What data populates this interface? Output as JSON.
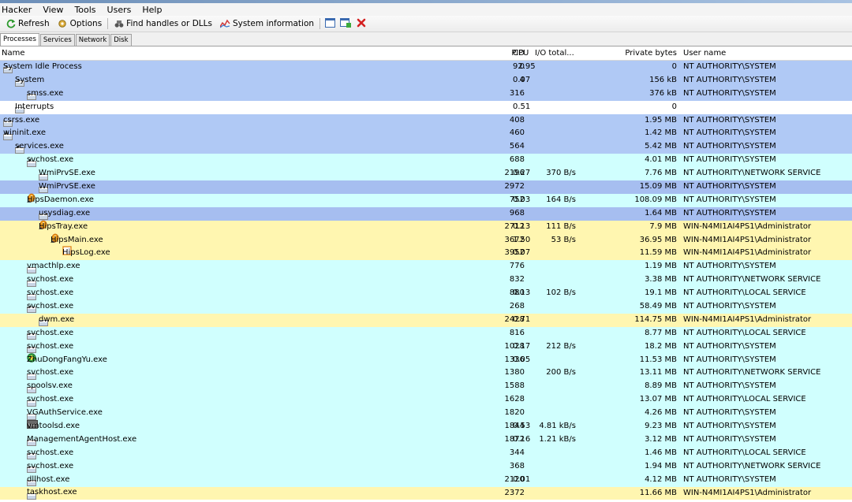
{
  "menu": [
    "Hacker",
    "View",
    "Tools",
    "Users",
    "Help"
  ],
  "toolbar": {
    "refresh": "Refresh",
    "options": "Options",
    "find": "Find handles or DLLs",
    "sysinfo": "System information"
  },
  "tabs": [
    "Processes",
    "Services",
    "Network",
    "Disk"
  ],
  "columns": {
    "name": "Name",
    "pid": "PID",
    "cpu": "CPU",
    "io": "I/O total...",
    "private": "Private bytes",
    "user": "User name"
  },
  "colors": {
    "service": "#b0c9f5",
    "process": "#d0fffe",
    "own": "#fff6b0",
    "system": "#ffffff"
  },
  "processes": [
    {
      "name": "System Idle Process",
      "pid": "0",
      "cpu": "92.95",
      "io": "",
      "priv": "0",
      "user": "NT AUTHORITY\\SYSTEM",
      "level": 0,
      "exp": true,
      "bg": "blue",
      "icon": "window-icon"
    },
    {
      "name": "System",
      "pid": "4",
      "cpu": "0.07",
      "io": "",
      "priv": "156 kB",
      "user": "NT AUTHORITY\\SYSTEM",
      "level": 1,
      "exp": true,
      "bg": "blue",
      "icon": "window-icon"
    },
    {
      "name": "smss.exe",
      "pid": "316",
      "cpu": "",
      "io": "",
      "priv": "376 kB",
      "user": "NT AUTHORITY\\SYSTEM",
      "level": 2,
      "exp": false,
      "bg": "blue",
      "icon": "window-icon"
    },
    {
      "name": "Interrupts",
      "pid": "",
      "cpu": "0.51",
      "io": "",
      "priv": "0",
      "user": "",
      "level": 1,
      "exp": false,
      "bg": "white",
      "icon": "window-icon"
    },
    {
      "name": "csrss.exe",
      "pid": "408",
      "cpu": "",
      "io": "",
      "priv": "1.95 MB",
      "user": "NT AUTHORITY\\SYSTEM",
      "level": 0,
      "exp": false,
      "bg": "blue",
      "icon": "window-icon"
    },
    {
      "name": "wininit.exe",
      "pid": "460",
      "cpu": "",
      "io": "",
      "priv": "1.42 MB",
      "user": "NT AUTHORITY\\SYSTEM",
      "level": 0,
      "exp": true,
      "bg": "blue",
      "icon": "window-icon"
    },
    {
      "name": "services.exe",
      "pid": "564",
      "cpu": "",
      "io": "",
      "priv": "5.42 MB",
      "user": "NT AUTHORITY\\SYSTEM",
      "level": 1,
      "exp": true,
      "bg": "blue",
      "icon": "window-icon"
    },
    {
      "name": "svchost.exe",
      "pid": "688",
      "cpu": "",
      "io": "",
      "priv": "4.01 MB",
      "user": "NT AUTHORITY\\SYSTEM",
      "level": 2,
      "exp": true,
      "bg": "cyan",
      "icon": "window-icon"
    },
    {
      "name": "WmiPrvSE.exe",
      "pid": "2196",
      "cpu": "0.27",
      "io": "370 B/s",
      "priv": "7.76 MB",
      "user": "NT AUTHORITY\\NETWORK SERVICE",
      "level": 3,
      "exp": false,
      "bg": "cyan",
      "icon": "window-icon"
    },
    {
      "name": "WmiPrvSE.exe",
      "pid": "2972",
      "cpu": "",
      "io": "",
      "priv": "15.09 MB",
      "user": "NT AUTHORITY\\SYSTEM",
      "level": 3,
      "exp": false,
      "bg": "dblue",
      "icon": "window-icon"
    },
    {
      "name": "HipsDaemon.exe",
      "pid": "752",
      "cpu": "0.03",
      "io": "164 B/s",
      "priv": "108.09 MB",
      "user": "NT AUTHORITY\\SYSTEM",
      "level": 2,
      "exp": true,
      "bg": "cyan",
      "icon": "shield-icon"
    },
    {
      "name": "usysdiag.exe",
      "pid": "968",
      "cpu": "",
      "io": "",
      "priv": "1.64 MB",
      "user": "NT AUTHORITY\\SYSTEM",
      "level": 3,
      "exp": false,
      "bg": "dblue",
      "icon": "window-icon"
    },
    {
      "name": "HipsTray.exe",
      "pid": "2712",
      "cpu": "0.13",
      "io": "111 B/s",
      "priv": "7.9 MB",
      "user": "WIN-N4MI1AI4PS1\\Administrator",
      "level": 3,
      "exp": true,
      "bg": "yellow",
      "icon": "shield-icon"
    },
    {
      "name": "HipsMain.exe",
      "pid": "3672",
      "cpu": "1.50",
      "io": "53 B/s",
      "priv": "36.95 MB",
      "user": "WIN-N4MI1AI4PS1\\Administrator",
      "level": 4,
      "exp": true,
      "bg": "yellow",
      "icon": "shield-icon"
    },
    {
      "name": "HipsLog.exe",
      "pid": "3952",
      "cpu": "0.07",
      "io": "",
      "priv": "11.59 MB",
      "user": "WIN-N4MI1AI4PS1\\Administrator",
      "level": 5,
      "exp": false,
      "bg": "yellow",
      "icon": "log-icon"
    },
    {
      "name": "vmacthlp.exe",
      "pid": "776",
      "cpu": "",
      "io": "",
      "priv": "1.19 MB",
      "user": "NT AUTHORITY\\SYSTEM",
      "level": 2,
      "exp": false,
      "bg": "cyan",
      "icon": "window-icon"
    },
    {
      "name": "svchost.exe",
      "pid": "832",
      "cpu": "",
      "io": "",
      "priv": "3.38 MB",
      "user": "NT AUTHORITY\\NETWORK SERVICE",
      "level": 2,
      "exp": false,
      "bg": "cyan",
      "icon": "window-icon"
    },
    {
      "name": "svchost.exe",
      "pid": "880",
      "cpu": "0.13",
      "io": "102 B/s",
      "priv": "19.1 MB",
      "user": "NT AUTHORITY\\LOCAL SERVICE",
      "level": 2,
      "exp": false,
      "bg": "cyan",
      "icon": "window-icon"
    },
    {
      "name": "svchost.exe",
      "pid": "268",
      "cpu": "",
      "io": "",
      "priv": "58.49 MB",
      "user": "NT AUTHORITY\\SYSTEM",
      "level": 2,
      "exp": true,
      "bg": "cyan",
      "icon": "window-icon"
    },
    {
      "name": "dwm.exe",
      "pid": "2428",
      "cpu": "0.71",
      "io": "",
      "priv": "114.75 MB",
      "user": "WIN-N4MI1AI4PS1\\Administrator",
      "level": 3,
      "exp": false,
      "bg": "yellow",
      "icon": "window-icon"
    },
    {
      "name": "svchost.exe",
      "pid": "816",
      "cpu": "",
      "io": "",
      "priv": "8.77 MB",
      "user": "NT AUTHORITY\\LOCAL SERVICE",
      "level": 2,
      "exp": false,
      "bg": "cyan",
      "icon": "window-icon"
    },
    {
      "name": "svchost.exe",
      "pid": "1028",
      "cpu": "0.17",
      "io": "212 B/s",
      "priv": "18.2 MB",
      "user": "NT AUTHORITY\\SYSTEM",
      "level": 2,
      "exp": false,
      "bg": "cyan",
      "icon": "window-icon"
    },
    {
      "name": "ZhuDongFangYu.exe",
      "pid": "1336",
      "cpu": "0.05",
      "io": "",
      "priv": "11.53 MB",
      "user": "NT AUTHORITY\\SYSTEM",
      "level": 2,
      "exp": false,
      "bg": "cyan",
      "icon": "plus-globe-icon"
    },
    {
      "name": "svchost.exe",
      "pid": "1380",
      "cpu": "",
      "io": "200 B/s",
      "priv": "13.11 MB",
      "user": "NT AUTHORITY\\NETWORK SERVICE",
      "level": 2,
      "exp": false,
      "bg": "cyan",
      "icon": "window-icon"
    },
    {
      "name": "spoolsv.exe",
      "pid": "1588",
      "cpu": "",
      "io": "",
      "priv": "8.89 MB",
      "user": "NT AUTHORITY\\SYSTEM",
      "level": 2,
      "exp": false,
      "bg": "cyan",
      "icon": "window-icon"
    },
    {
      "name": "svchost.exe",
      "pid": "1628",
      "cpu": "",
      "io": "",
      "priv": "13.07 MB",
      "user": "NT AUTHORITY\\LOCAL SERVICE",
      "level": 2,
      "exp": false,
      "bg": "cyan",
      "icon": "window-icon"
    },
    {
      "name": "VGAuthService.exe",
      "pid": "1820",
      "cpu": "",
      "io": "",
      "priv": "4.26 MB",
      "user": "NT AUTHORITY\\SYSTEM",
      "level": 2,
      "exp": false,
      "bg": "cyan",
      "icon": "window-icon"
    },
    {
      "name": "vmtoolsd.exe",
      "pid": "1844",
      "cpu": "0.53",
      "io": "4.81 kB/s",
      "priv": "9.23 MB",
      "user": "NT AUTHORITY\\SYSTEM",
      "level": 2,
      "exp": false,
      "bg": "cyan",
      "icon": "vm-icon"
    },
    {
      "name": "ManagementAgentHost.exe",
      "pid": "1872",
      "cpu": "0.16",
      "io": "1.21 kB/s",
      "priv": "3.12 MB",
      "user": "NT AUTHORITY\\SYSTEM",
      "level": 2,
      "exp": false,
      "bg": "cyan",
      "icon": "window-icon"
    },
    {
      "name": "svchost.exe",
      "pid": "344",
      "cpu": "",
      "io": "",
      "priv": "1.46 MB",
      "user": "NT AUTHORITY\\LOCAL SERVICE",
      "level": 2,
      "exp": false,
      "bg": "cyan",
      "icon": "window-icon"
    },
    {
      "name": "svchost.exe",
      "pid": "368",
      "cpu": "",
      "io": "",
      "priv": "1.94 MB",
      "user": "NT AUTHORITY\\NETWORK SERVICE",
      "level": 2,
      "exp": false,
      "bg": "cyan",
      "icon": "window-icon"
    },
    {
      "name": "dllhost.exe",
      "pid": "2120",
      "cpu": "0.01",
      "io": "",
      "priv": "4.12 MB",
      "user": "NT AUTHORITY\\SYSTEM",
      "level": 2,
      "exp": false,
      "bg": "cyan",
      "icon": "window-icon"
    },
    {
      "name": "taskhost.exe",
      "pid": "2372",
      "cpu": "",
      "io": "",
      "priv": "11.66 MB",
      "user": "WIN-N4MI1AI4PS1\\Administrator",
      "level": 2,
      "exp": false,
      "bg": "yellow",
      "icon": "window-icon"
    }
  ]
}
